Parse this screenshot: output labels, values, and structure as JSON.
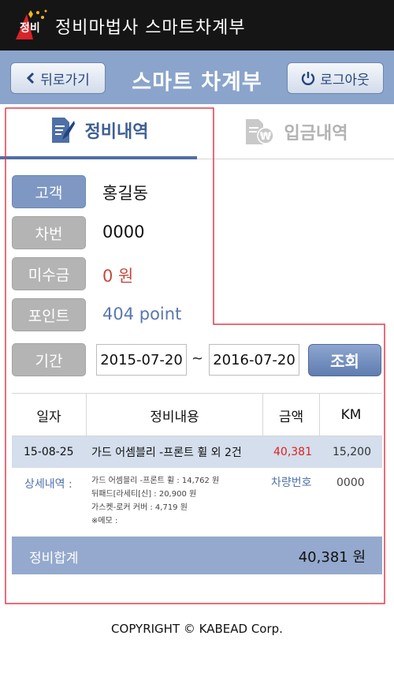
{
  "app": {
    "logo_text": "정비",
    "title": "정비마법사 스마트차계부"
  },
  "header": {
    "back_label": "뒤로가기",
    "title": "스마트 차계부",
    "logout_label": "로그아웃"
  },
  "tabs": [
    {
      "label": "정비내역",
      "active": true
    },
    {
      "label": "입금내역",
      "active": false
    }
  ],
  "fields": {
    "customer": {
      "label": "고객",
      "value": "홍길동"
    },
    "plate": {
      "label": "차번",
      "value": "0000"
    },
    "unpaid": {
      "label": "미수금",
      "value": "0 원"
    },
    "points": {
      "label": "포인트",
      "value": "404 point"
    }
  },
  "period": {
    "label": "기간",
    "from": "2015-07-20",
    "separator": "~",
    "to": "2016-07-20",
    "search_label": "조회"
  },
  "table": {
    "headers": [
      "일자",
      "정비내용",
      "금액",
      "KM"
    ],
    "row": {
      "date": "15-08-25",
      "content": "가드 어셈블리 -프론트 휠 외 2건",
      "amount": "40,381",
      "km": "15,200"
    },
    "detail": {
      "label": "상세내역 :",
      "lines": [
        "가드 어셈블리 -프론트 휠 : 14,762 원",
        "뒤패드[라세티[신] : 20,900 원",
        "가스켓-로커 커버 : 4,719 원",
        "※메모 :"
      ],
      "car_label": "차량번호",
      "car_value": "0000"
    },
    "total_label": "정비합계",
    "total_value": "40,381 원"
  },
  "footer": {
    "copyright": "COPYRIGHT © KABEAD Corp."
  },
  "colors": {
    "header": "#8aa4cb",
    "accent": "#4f6fa6",
    "amount": "#e0201b",
    "highlight": "#e53b4a"
  }
}
